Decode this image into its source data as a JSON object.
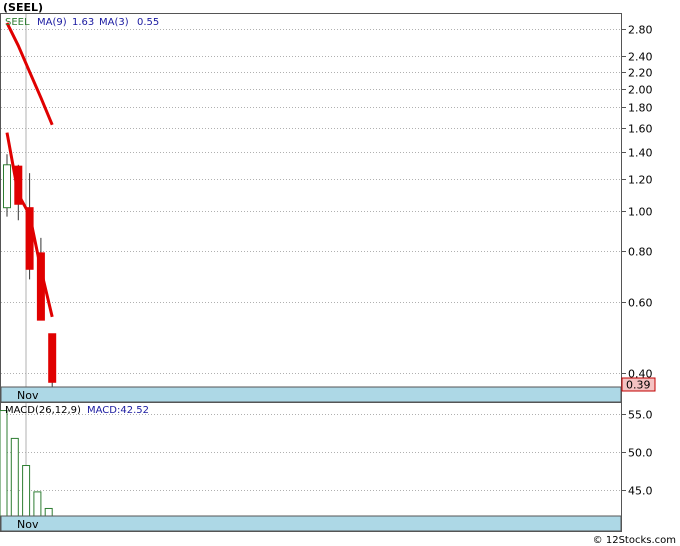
{
  "ticker_title": "(SEEL)",
  "watermark": "© 12Stocks.com",
  "colors": {
    "up": "#2e7d32",
    "down": "#e00000",
    "ma": "#e00000",
    "label_blue": "#1a1aa0",
    "axis_strip": "#add8e6",
    "grid": "#b0b0b0",
    "price_tag_bg": "#f4c2c2"
  },
  "chart_data": [
    {
      "type": "candlestick",
      "x_label_nov": "Nov",
      "y_scale": "log",
      "ylim": [
        0.37,
        3.05
      ],
      "y_ticks": [
        0.4,
        0.6,
        0.8,
        1.0,
        1.2,
        1.4,
        1.6,
        1.8,
        2.0,
        2.2,
        2.4,
        2.8
      ],
      "y_tick_labels": [
        "0.40",
        "0.60",
        "0.80",
        "1.00",
        "1.20",
        "1.40",
        "1.60",
        "1.80",
        "2.00",
        "2.20",
        "2.40",
        "2.80"
      ],
      "last_price_label": "0.39",
      "last_price": 0.39,
      "legend": {
        "symbol": "SEEL",
        "ma9_label": "MA(9)",
        "ma9_value": "1.63",
        "ma3_label": "MA(3)",
        "ma3_value": "0.55"
      },
      "candles": [
        {
          "open": 1.02,
          "close": 1.3,
          "high": 1.38,
          "low": 0.97
        },
        {
          "open": 1.29,
          "close": 1.04,
          "high": 1.3,
          "low": 0.95
        },
        {
          "open": 1.02,
          "close": 0.72,
          "high": 1.24,
          "low": 0.68
        },
        {
          "open": 0.79,
          "close": 0.54,
          "high": 0.86,
          "low": 0.54
        },
        {
          "open": 0.5,
          "close": 0.38,
          "high": 0.5,
          "low": 0.37
        }
      ],
      "ma9": [
        2.9,
        2.55,
        2.2,
        1.9,
        1.63
      ],
      "ma3": [
        1.56,
        1.1,
        0.98,
        0.72,
        0.55
      ]
    },
    {
      "type": "bar",
      "x_label_nov": "Nov",
      "ylim": [
        41.5,
        56.5
      ],
      "y_ticks": [
        45.0,
        50.0,
        55.0
      ],
      "y_tick_labels": [
        "45.0",
        "50.0",
        "55.0"
      ],
      "legend": {
        "name": "MACD(26,12,9)",
        "value_label": "MACD:42.52"
      },
      "values": [
        55.5,
        51.8,
        48.2,
        44.7,
        42.5
      ]
    }
  ]
}
